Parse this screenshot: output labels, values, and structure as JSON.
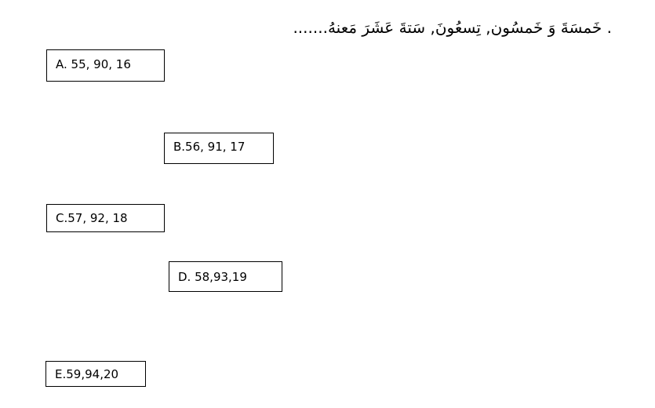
{
  "question": {
    "text": ". خَمسَةَ وَ خَمسُون, تِسعُونَ, سَتةَ عَشَرَ  مَعنهُ......."
  },
  "options": [
    {
      "label": "A. 55, 90, 16"
    },
    {
      "label": "B.56, 91, 17"
    },
    {
      "label": "C.57, 92, 18"
    },
    {
      "label": "D. 58,93,19"
    },
    {
      "label": "E.59,94,20"
    }
  ]
}
